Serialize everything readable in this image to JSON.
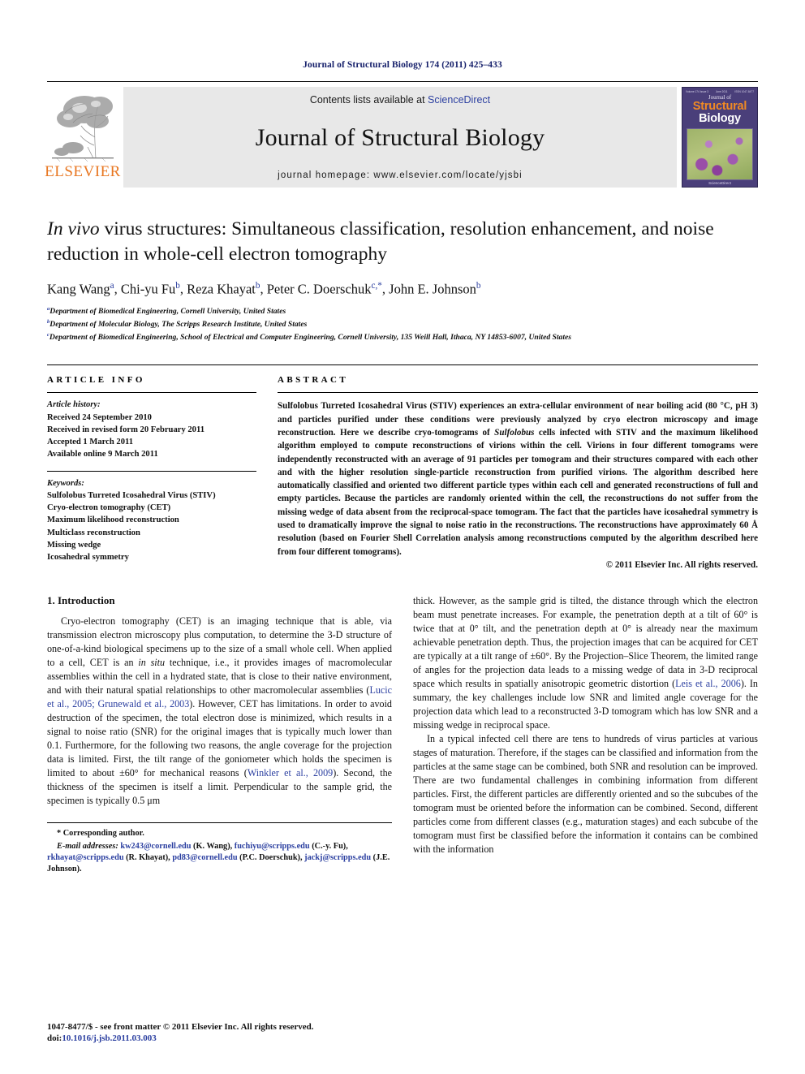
{
  "running_head": "Journal of Structural Biology 174 (2011) 425–433",
  "masthead": {
    "publisher_name": "ELSEVIER",
    "contents_prefix": "Contents lists available at ",
    "sciencedirect": "ScienceDirect",
    "journal_title": "Journal of Structural Biology",
    "homepage": "journal homepage: www.elsevier.com/locate/yjsbi",
    "cover": {
      "top_left": "Volume 174 Issue 3",
      "top_center": "June 2011",
      "top_right": "ISSN 1047-8477",
      "journal_of": "Journal of",
      "structural": "Structural",
      "biology": "Biology",
      "footer": "ScienceDirect"
    }
  },
  "article": {
    "title_line1_italic": "In vivo",
    "title_line1_rest": " virus structures: Simultaneous classification, resolution enhancement,",
    "title_line2": "and noise reduction in whole-cell electron tomography",
    "authors": [
      {
        "name": "Kang Wang",
        "sup": "a",
        "sep": ", "
      },
      {
        "name": "Chi-yu Fu",
        "sup": "b",
        "sep": ", "
      },
      {
        "name": "Reza Khayat",
        "sup": "b",
        "sep": ", "
      },
      {
        "name": "Peter C. Doerschuk",
        "sup": "c,*",
        "sep": ", "
      },
      {
        "name": "John E. Johnson",
        "sup": "b",
        "sep": ""
      }
    ],
    "affiliations": [
      {
        "mark": "a",
        "text": "Department of Biomedical Engineering, Cornell University, United States"
      },
      {
        "mark": "b",
        "text": "Department of Molecular Biology, The Scripps Research Institute, United States"
      },
      {
        "mark": "c",
        "text": "Department of Biomedical Engineering, School of Electrical and Computer Engineering, Cornell University, 135 Weill Hall, Ithaca, NY 14853-6007, United States"
      }
    ]
  },
  "article_info": {
    "heading": "ARTICLE INFO",
    "history_label": "Article history:",
    "history": [
      "Received 24 September 2010",
      "Received in revised form 20 February 2011",
      "Accepted 1 March 2011",
      "Available online 9 March 2011"
    ],
    "keywords_label": "Keywords:",
    "keywords": [
      "Sulfolobus Turreted Icosahedral Virus (STIV)",
      "Cryo-electron tomography (CET)",
      "Maximum likelihood reconstruction",
      "Multiclass reconstruction",
      "Missing wedge",
      "Icosahedral symmetry"
    ]
  },
  "abstract": {
    "heading": "ABSTRACT",
    "part1": "Sulfolobus Turreted Icosahedral Virus (STIV) experiences an extra-cellular environment of near boiling acid (80 °C, pH 3) and particles purified under these conditions were previously analyzed by cryo electron microscopy and image reconstruction. Here we describe cryo-tomograms of ",
    "italic1": "Sulfolobus",
    "part2": " cells infected with STIV and the maximum likelihood algorithm employed to compute reconstructions of virions within the cell. Virions in four different tomograms were independently reconstructed with an average of 91 particles per tomogram and their structures compared with each other and with the higher resolution single-particle reconstruction from purified virions. The algorithm described here automatically classified and oriented two different particle types within each cell and generated reconstructions of full and empty particles. Because the particles are randomly oriented within the cell, the reconstructions do not suffer from the missing wedge of data absent from the reciprocal-space tomogram. The fact that the particles have icosahedral symmetry is used to dramatically improve the signal to noise ratio in the reconstructions. The reconstructions have approximately 60 Å resolution (based on Fourier Shell Correlation analysis among reconstructions computed by the algorithm described here from four different tomograms).",
    "copyright": "© 2011 Elsevier Inc. All rights reserved."
  },
  "body": {
    "section_title": "1. Introduction",
    "left_p1_a": "Cryo-electron tomography (CET) is an imaging technique that is able, via transmission electron microscopy plus computation, to determine the 3-D structure of one-of-a-kind biological specimens up to the size of a small whole cell. When applied to a cell, CET is an ",
    "left_p1_italic": "in situ",
    "left_p1_b": " technique, i.e., it provides images of macromolecular assemblies within the cell in a hydrated state, that is close to their native environment, and with their natural spatial relationships to other macromolecular assemblies (",
    "left_cite1": "Lucic et al., 2005; Grunewald et al., 2003",
    "left_p1_c": "). However, CET has limitations. In order to avoid destruction of the specimen, the total electron dose is minimized, which results in a signal to noise ratio (SNR) for the original images that is typically much lower than 0.1. Furthermore, for the following two reasons, the angle coverage for the projection data is limited. First, the tilt range of the goniometer which holds the specimen is limited to about ±60° for mechanical reasons (",
    "left_cite2": "Winkler et al., 2009",
    "left_p1_d": "). Second, the thickness of the specimen is itself a limit. Perpendicular to the sample grid, the specimen is typically 0.5 μm",
    "right_p1_a": "thick. However, as the sample grid is tilted, the distance through which the electron beam must penetrate increases. For example, the penetration depth at a tilt of 60° is twice that at 0° tilt, and the penetration depth at 0° is already near the maximum achievable penetration depth. Thus, the projection images that can be acquired for CET are typically at a tilt range of ±60°. By the Projection–Slice Theorem, the limited range of angles for the projection data leads to a missing wedge of data in 3-D reciprocal space which results in spatially anisotropic geometric distortion (",
    "right_cite1": "Leis et al., 2006",
    "right_p1_b": "). In summary, the key challenges include low SNR and limited angle coverage for the projection data which lead to a reconstructed 3-D tomogram which has low SNR and a missing wedge in reciprocal space.",
    "right_p2": "In a typical infected cell there are tens to hundreds of virus particles at various stages of maturation. Therefore, if the stages can be classified and information from the particles at the same stage can be combined, both SNR and resolution can be improved. There are two fundamental challenges in combining information from different particles. First, the different particles are differently oriented and so the subcubes of the tomogram must be oriented before the information can be combined. Second, different particles come from different classes (e.g., maturation stages) and each subcube of the tomogram must first be classified before the information it contains can be combined with the information"
  },
  "footnote": {
    "star": "*",
    "corresponding": "Corresponding author.",
    "email_label": "E-mail addresses:",
    "emails": [
      {
        "addr": "kw243@cornell.edu",
        "who": " (K. Wang), "
      },
      {
        "addr": "fuchiyu@scripps.edu",
        "who": " (C.-y. Fu), "
      },
      {
        "addr": "rkhayat@scripps.edu",
        "who": " (R. Khayat), "
      },
      {
        "addr": "pd83@cornell.edu",
        "who": " (P.C. Doerschuk), "
      },
      {
        "addr": "jackj@scripps.edu",
        "who": " (J.E. Johnson)."
      }
    ]
  },
  "issn_line": {
    "front_matter": "1047-8477/$ - see front matter © 2011 Elsevier Inc. All rights reserved.",
    "doi_label": "doi:",
    "doi_value": "10.1016/j.jsb.2011.03.003"
  },
  "colors": {
    "link_blue": "#2b3fa0",
    "running_head_blue": "#16206b",
    "elsevier_orange": "#E87722",
    "banner_gray": "#e8e8e8",
    "cover_purple": "#4a3f7a",
    "cover_orange": "#f08a24"
  }
}
